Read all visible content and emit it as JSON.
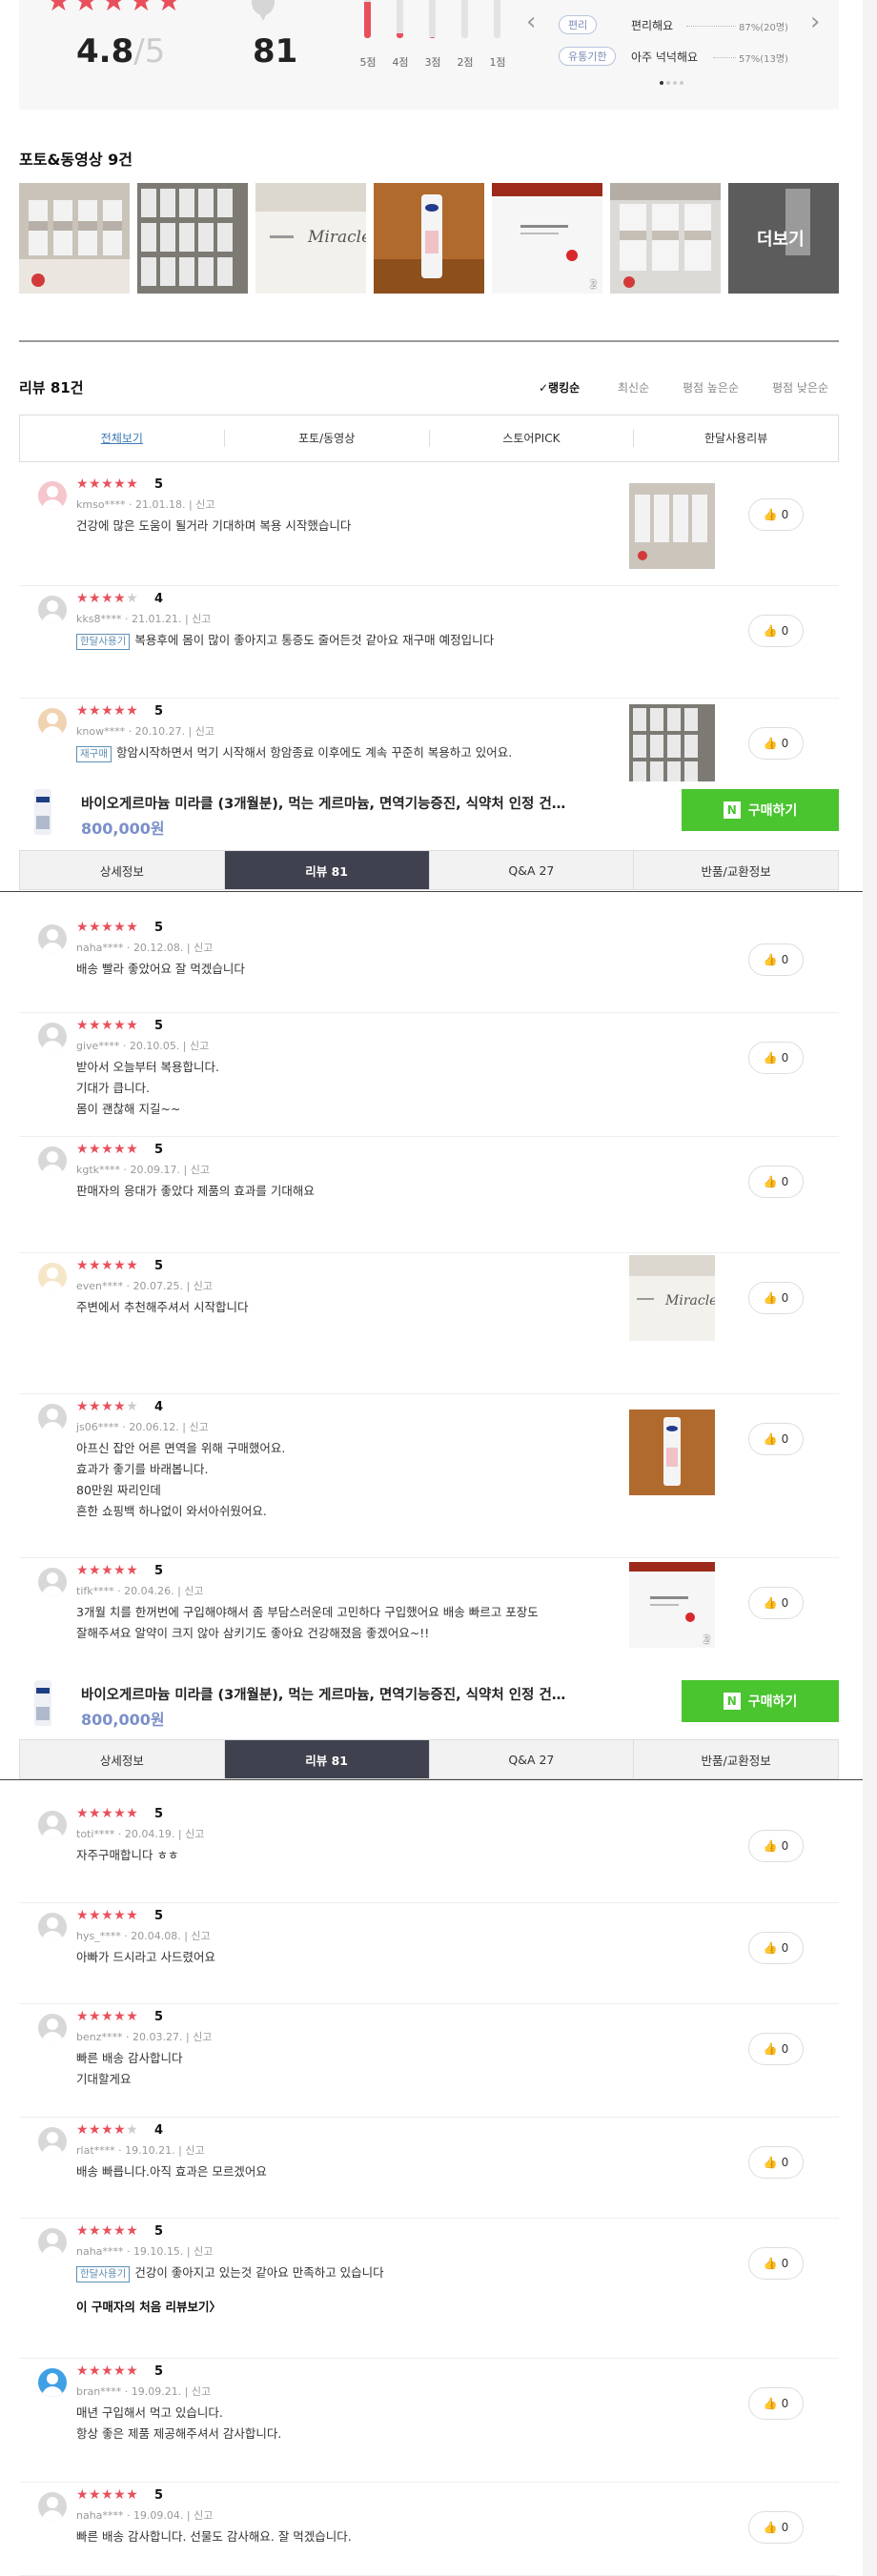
{
  "summary": {
    "avg_score": "4.8",
    "avg_max": "/5",
    "review_count": "81",
    "distribution": [
      {
        "label": "5점",
        "fraction": 0.86
      },
      {
        "label": "4점",
        "fraction": 0.12
      },
      {
        "label": "3점",
        "fraction": 0.02
      },
      {
        "label": "2점",
        "fraction": 0.0
      },
      {
        "label": "1점",
        "fraction": 0.0
      }
    ],
    "keywords": [
      {
        "tag": "편리",
        "text": "편리해요",
        "pct": "87%(20명)"
      },
      {
        "tag": "유통기한",
        "text": "아주 넉넉해요",
        "pct": "57%(13명)"
      }
    ]
  },
  "photos": {
    "title": "포토&동영상 9건",
    "more_label": "더보기",
    "badge_count": "2"
  },
  "reviews_header": {
    "title": "리뷰 81건",
    "sort_options": [
      "✓랭킹순",
      "최신순",
      "평점 높은순",
      "평점 낮은순"
    ],
    "filter_tabs": [
      "전체보기",
      "포토/동영상",
      "스토어PICK",
      "한달사용리뷰"
    ]
  },
  "buybar": {
    "product_name": "바이오게르마늄 미라클 (3개월분), 먹는 게르마늄, 면역기능증진, 식약처 인정 건…",
    "price": "800,000원",
    "buy_label": "구매하기",
    "n_logo": "N"
  },
  "tabs": [
    "상세정보",
    "리뷰 81",
    "Q&A 27",
    "반품/교환정보"
  ],
  "report_label": "신고",
  "first_review_link": "이 구매자의 처음 리뷰보기〉",
  "reviews": [
    {
      "stars": "★★★★★",
      "stars_off": "",
      "score": "5",
      "user": "kmso****",
      "date": "21.01.18.",
      "badge": "",
      "text": "건강에 많은 도움이 될거라 기대하며 복용 시작했습니다",
      "likes": "0"
    },
    {
      "stars": "★★★★",
      "stars_off": "★",
      "score": "4",
      "user": "kks8****",
      "date": "21.01.21.",
      "badge": "한달사용기",
      "text": "복용후에 몸이 많이 좋아지고 통증도 줄어든것 같아요 재구매 예정입니다",
      "likes": "0"
    },
    {
      "stars": "★★★★★",
      "stars_off": "",
      "score": "5",
      "user": "know****",
      "date": "20.10.27.",
      "badge": "재구매",
      "text": "항암시작하면서 먹기 시작해서 항암종료 이후에도 계속 꾸준히 복용하고 있어요.",
      "likes": "0"
    },
    {
      "stars": "★★★★★",
      "stars_off": "",
      "score": "5",
      "user": "naha****",
      "date": "20.12.08.",
      "badge": "",
      "text": "배송 빨라 좋았어요 잘 먹겠습니다",
      "likes": "0"
    },
    {
      "stars": "★★★★★",
      "stars_off": "",
      "score": "5",
      "user": "give****",
      "date": "20.10.05.",
      "badge": "",
      "text": "받아서 오늘부터 복용합니다.\n기대가 큽니다.\n몸이 괜찮해 지길~~",
      "likes": "0"
    },
    {
      "stars": "★★★★★",
      "stars_off": "",
      "score": "5",
      "user": "kgtk****",
      "date": "20.09.17.",
      "badge": "",
      "text": "판매자의 응대가 좋았다 제품의 효과를 기대해요",
      "likes": "0"
    },
    {
      "stars": "★★★★★",
      "stars_off": "",
      "score": "5",
      "user": "even****",
      "date": "20.07.25.",
      "badge": "",
      "text": "주변에서 추천해주셔서 시작합니다",
      "likes": "0"
    },
    {
      "stars": "★★★★",
      "stars_off": "★",
      "score": "4",
      "user": "js06****",
      "date": "20.06.12.",
      "badge": "",
      "text": "아프신 잡안 어른 면역을 위해 구매했어요.\n효과가 좋기를 바래봅니다.\n80만원 짜리인데\n흔한 쇼핑백 하나없이 와서아쉬웠어요.",
      "likes": "0"
    },
    {
      "stars": "★★★★★",
      "stars_off": "",
      "score": "5",
      "user": "tifk****",
      "date": "20.04.26.",
      "badge": "",
      "text": "3개월 치를 한꺼번에 구입해야해서 좀 부담스러운데 고민하다 구입했어요 배송 빠르고 포장도\n잘해주셔요 알약이 크지 않아 삼키기도 좋아요 건강해졌음 좋겠어요~!!",
      "likes": "0"
    },
    {
      "stars": "★★★★★",
      "stars_off": "",
      "score": "5",
      "user": "toti****",
      "date": "20.04.19.",
      "badge": "",
      "text": "자주구매합니다 ㅎㅎ",
      "likes": "0"
    },
    {
      "stars": "★★★★★",
      "stars_off": "",
      "score": "5",
      "user": "hys_****",
      "date": "20.04.08.",
      "badge": "",
      "text": "아빠가 드시라고 사드렸어요",
      "likes": "0"
    },
    {
      "stars": "★★★★★",
      "stars_off": "",
      "score": "5",
      "user": "benz****",
      "date": "20.03.27.",
      "badge": "",
      "text": "빠른 배송 감사합니다\n 기대할게요",
      "likes": "0"
    },
    {
      "stars": "★★★★",
      "stars_off": "★",
      "score": "4",
      "user": "rlat****",
      "date": "19.10.21.",
      "badge": "",
      "text": "배송 빠릅니다.아직 효과은 모르겠어요",
      "likes": "0"
    },
    {
      "stars": "★★★★★",
      "stars_off": "",
      "score": "5",
      "user": "naha****",
      "date": "19.10.15.",
      "badge": "한달사용기",
      "text": "건강이 좋아지고 있는것 같아요 만족하고 있습니다",
      "likes": "0"
    },
    {
      "stars": "★★★★★",
      "stars_off": "",
      "score": "5",
      "user": "bran****",
      "date": "19.09.21.",
      "badge": "",
      "text": "매년 구입해서 먹고 있습니다.\n항상 좋은 제품 제공해주셔서 감사합니다.",
      "likes": "0"
    },
    {
      "stars": "★★★★★",
      "stars_off": "",
      "score": "5",
      "user": "naha****",
      "date": "19.09.04.",
      "badge": "",
      "text": "빠른 배송 감사합니다. 선물도 감사해요. 잘 먹겠습니다.",
      "likes": "0"
    }
  ]
}
